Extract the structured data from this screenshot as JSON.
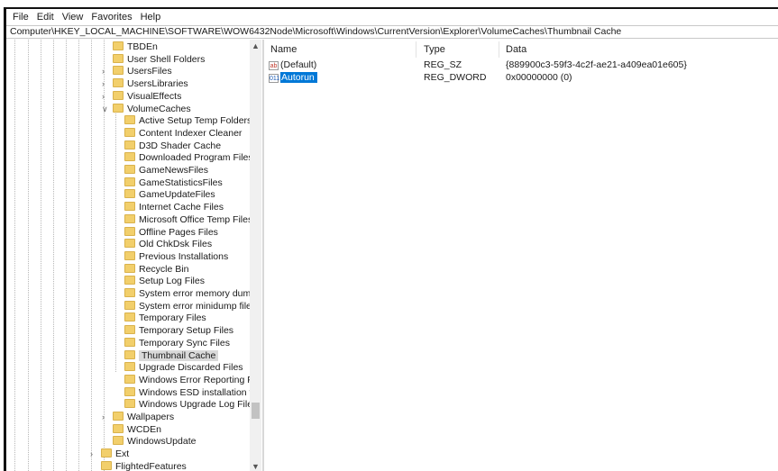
{
  "menu": [
    "File",
    "Edit",
    "View",
    "Favorites",
    "Help"
  ],
  "address": "Computer\\HKEY_LOCAL_MACHINE\\SOFTWARE\\WOW6432Node\\Microsoft\\Windows\\CurrentVersion\\Explorer\\VolumeCaches\\Thumbnail Cache",
  "tree": [
    {
      "label": "TBDEn",
      "level": 1,
      "expander": ""
    },
    {
      "label": "User Shell Folders",
      "level": 1,
      "expander": ""
    },
    {
      "label": "UsersFiles",
      "level": 1,
      "expander": ">"
    },
    {
      "label": "UsersLibraries",
      "level": 1,
      "expander": ">"
    },
    {
      "label": "VisualEffects",
      "level": 1,
      "expander": ">"
    },
    {
      "label": "VolumeCaches",
      "level": 1,
      "expander": "v"
    },
    {
      "label": "Active Setup Temp Folders",
      "level": 2,
      "expander": ""
    },
    {
      "label": "Content Indexer Cleaner",
      "level": 2,
      "expander": ""
    },
    {
      "label": "D3D Shader Cache",
      "level": 2,
      "expander": ""
    },
    {
      "label": "Downloaded Program Files",
      "level": 2,
      "expander": ""
    },
    {
      "label": "GameNewsFiles",
      "level": 2,
      "expander": ""
    },
    {
      "label": "GameStatisticsFiles",
      "level": 2,
      "expander": ""
    },
    {
      "label": "GameUpdateFiles",
      "level": 2,
      "expander": ""
    },
    {
      "label": "Internet Cache Files",
      "level": 2,
      "expander": ""
    },
    {
      "label": "Microsoft Office Temp Files",
      "level": 2,
      "expander": ""
    },
    {
      "label": "Offline Pages Files",
      "level": 2,
      "expander": ""
    },
    {
      "label": "Old ChkDsk Files",
      "level": 2,
      "expander": ""
    },
    {
      "label": "Previous Installations",
      "level": 2,
      "expander": ""
    },
    {
      "label": "Recycle Bin",
      "level": 2,
      "expander": ""
    },
    {
      "label": "Setup Log Files",
      "level": 2,
      "expander": ""
    },
    {
      "label": "System error memory dump fil",
      "level": 2,
      "expander": ""
    },
    {
      "label": "System error minidump files",
      "level": 2,
      "expander": ""
    },
    {
      "label": "Temporary Files",
      "level": 2,
      "expander": ""
    },
    {
      "label": "Temporary Setup Files",
      "level": 2,
      "expander": ""
    },
    {
      "label": "Temporary Sync Files",
      "level": 2,
      "expander": ""
    },
    {
      "label": "Thumbnail Cache",
      "level": 2,
      "expander": "",
      "selected": true
    },
    {
      "label": "Upgrade Discarded Files",
      "level": 2,
      "expander": ""
    },
    {
      "label": "Windows Error Reporting Files",
      "level": 2,
      "expander": ""
    },
    {
      "label": "Windows ESD installation files",
      "level": 2,
      "expander": ""
    },
    {
      "label": "Windows Upgrade Log Files",
      "level": 2,
      "expander": ""
    },
    {
      "label": "Wallpapers",
      "level": 1,
      "expander": ">"
    },
    {
      "label": "WCDEn",
      "level": 1,
      "expander": ""
    },
    {
      "label": "WindowsUpdate",
      "level": 1,
      "expander": ""
    },
    {
      "label": "Ext",
      "level": 0,
      "expander": ">"
    },
    {
      "label": "FlightedFeatures",
      "level": 0,
      "expander": ""
    }
  ],
  "columns": {
    "name": "Name",
    "type": "Type",
    "data": "Data"
  },
  "values": [
    {
      "name": "(Default)",
      "type": "REG_SZ",
      "data": "{889900c3-59f3-4c2f-ae21-a409ea01e605}",
      "icon": "string-value-icon",
      "icon_text": "ab",
      "kind": "sz"
    },
    {
      "name": "Autorun",
      "type": "REG_DWORD",
      "data": "0x00000000 (0)",
      "icon": "binary-value-icon",
      "icon_text": "011",
      "kind": "dw",
      "selected": true
    }
  ],
  "colors": {
    "folder": "#f2cf6b",
    "selection": "#0078d7",
    "tree_selection": "#d9d9d9"
  }
}
